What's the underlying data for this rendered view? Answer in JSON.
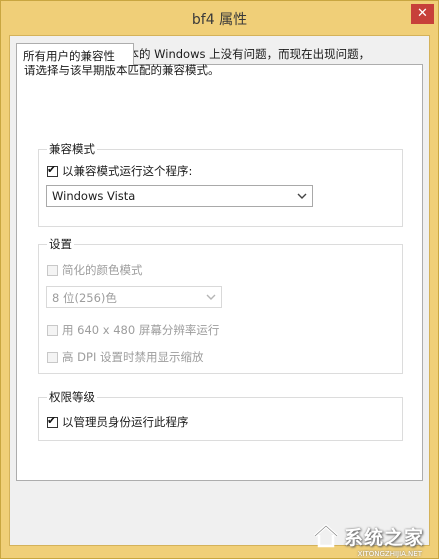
{
  "window": {
    "title": "bf4 属性",
    "close_glyph": "✕"
  },
  "tab": {
    "label": "所有用户的兼容性"
  },
  "intro": {
    "line1": "如果此程序在早期版本的 Windows 上没有问题，而现在出现问题，",
    "line2": "请选择与该早期版本匹配的兼容模式。"
  },
  "compat_mode": {
    "title": "兼容模式",
    "checkbox_label": "以兼容模式运行这个程序:",
    "checked": true,
    "selected_os": "Windows Vista"
  },
  "settings": {
    "title": "设置",
    "reduced_color_label": "简化的颜色模式",
    "color_select_value": "8 位(256)色",
    "resolution_label": "用 640 x 480 屏幕分辨率运行",
    "dpi_label": "高 DPI 设置时禁用显示缩放"
  },
  "privilege": {
    "title": "权限等级",
    "admin_label": "以管理员身份运行此程序",
    "checked": true
  },
  "watermark": {
    "text": "系统之家",
    "url": "XITONGZHIJIA.NET",
    "icon": "house-logo-icon"
  },
  "colors": {
    "title_bar": "#f0cf78",
    "close_button": "#c7403a",
    "disabled_text": "#9d9d9d"
  }
}
